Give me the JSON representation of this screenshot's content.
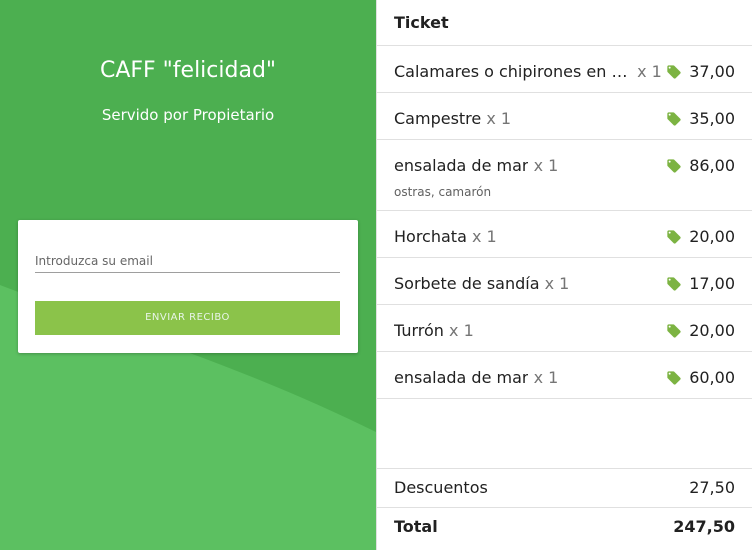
{
  "store": {
    "title": "CAFF \"felicidad\"",
    "served_by": "Servido por Propietario"
  },
  "receipt_form": {
    "email_placeholder": "Introduzca su email",
    "send_label": "ENVIAR RECIBO"
  },
  "ticket": {
    "header": "Ticket",
    "items": [
      {
        "name": "Calamares o chipirones en salsa",
        "qty": "x 1",
        "price": "37,00",
        "note": ""
      },
      {
        "name": "Campestre",
        "qty": "x 1",
        "price": "35,00",
        "note": ""
      },
      {
        "name": "ensalada de mar",
        "qty": "x 1",
        "price": "86,00",
        "note": "ostras, camarón"
      },
      {
        "name": "Horchata",
        "qty": "x 1",
        "price": "20,00",
        "note": ""
      },
      {
        "name": "Sorbete de sandía",
        "qty": "x 1",
        "price": "17,00",
        "note": ""
      },
      {
        "name": "Turrón",
        "qty": "x 1",
        "price": "20,00",
        "note": ""
      },
      {
        "name": "ensalada de mar",
        "qty": "x 1",
        "price": "60,00",
        "note": ""
      }
    ],
    "discounts_label": "Descuentos",
    "discounts_value": "27,50",
    "total_label": "Total",
    "total_value": "247,50"
  },
  "colors": {
    "primary_green": "#4caf50",
    "wave_green": "#5cc061",
    "button_green": "#8bc34a",
    "tag_icon": "#7cb342"
  },
  "icons": {
    "price": "tag-icon"
  }
}
